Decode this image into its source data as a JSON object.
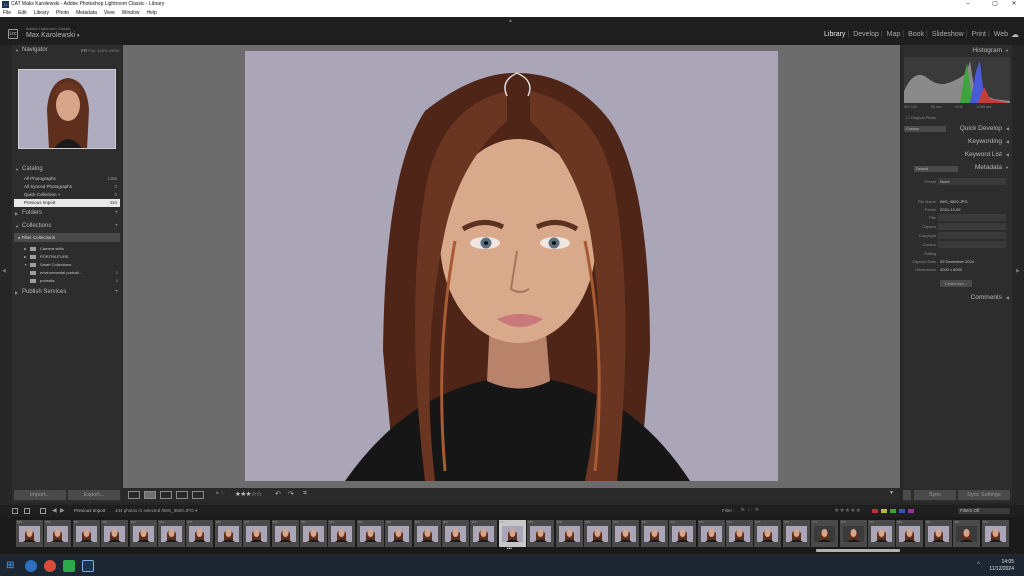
{
  "window": {
    "title": "CAT Maks Karolewski - Adobe Photoshop Lightroom Classic - Library",
    "icon_text": "Lr",
    "controls": [
      "–",
      "▢",
      "✕"
    ]
  },
  "menu": [
    "File",
    "Edit",
    "Library",
    "Photo",
    "Metadata",
    "View",
    "Window",
    "Help"
  ],
  "identity": {
    "small": "Adobe Lightroom Classic",
    "name": "Max Karolewski",
    "logo": "Lrc"
  },
  "modules": [
    "Library",
    "Develop",
    "Map",
    "Book",
    "Slideshow",
    "Print",
    "Web"
  ],
  "active_module": "Library",
  "left": {
    "navigator": {
      "title": "Navigator",
      "zoom": [
        "FIT",
        "FILL",
        "100%",
        "200%"
      ]
    },
    "catalog": {
      "title": "Catalog",
      "items": [
        {
          "label": "All Photographs",
          "count": "1456"
        },
        {
          "label": "All Synced Photographs",
          "count": "0"
        },
        {
          "label": "Quick Collection +",
          "count": "0"
        },
        {
          "label": "Previous Import",
          "count": "434"
        }
      ]
    },
    "folders": {
      "title": "Folders"
    },
    "collections": {
      "title": "Collections",
      "filter": "Filter Collections",
      "items": [
        {
          "label": "Camera skills",
          "count": ""
        },
        {
          "label": "PORTRAITURE",
          "count": ""
        },
        {
          "label": "Smart Collections",
          "count": ""
        },
        {
          "label": "environmental portrait...",
          "count": "1"
        },
        {
          "label": "portraits",
          "count": "0"
        }
      ]
    },
    "publish": {
      "title": "Publish Services"
    },
    "import_label": "Import...",
    "export_label": "Export..."
  },
  "right": {
    "histogram": {
      "title": "Histogram",
      "info": [
        "ISO 100",
        "85 mm",
        "f/2.8",
        "1/160 sec"
      ],
      "original_photo": "Original Photo"
    },
    "quick_develop": {
      "title": "Quick Develop",
      "preset": "Custom"
    },
    "keywording": {
      "title": "Keywording"
    },
    "keyword_list": {
      "title": "Keyword List"
    },
    "metadata": {
      "title": "Metadata",
      "preset_selector": "Default",
      "preset_label": "Preset",
      "preset_value": "None",
      "fields": [
        {
          "key": "File Name",
          "value": "IMG_9820.JPG",
          "box": false
        },
        {
          "key": "Folder",
          "value": "2024-12-09",
          "box": false
        },
        {
          "key": "Title",
          "value": "",
          "box": true
        },
        {
          "key": "Caption",
          "value": "",
          "box": true
        },
        {
          "key": "Copyright",
          "value": "",
          "box": true
        },
        {
          "key": "Creator",
          "value": "",
          "box": true
        },
        {
          "key": "Rating",
          "value": "",
          "box": false
        },
        {
          "key": "Capture Date",
          "value": "09 December 2024",
          "box": false
        },
        {
          "key": "Dimensions",
          "value": "4000 x 6000",
          "box": false
        }
      ],
      "customize": "Customize..."
    },
    "comments": {
      "title": "Comments"
    },
    "sync_label": "Sync",
    "sync_settings_label": "Sync Settings"
  },
  "toolbar": {
    "rating_stars": "★★★☆☆"
  },
  "filmstrip_header": {
    "source": "Previous Import",
    "info": "434 photos /1 selected /IMG_9820.JPG ▾",
    "filter_label": "Filter :",
    "filter_value": "Filters Off",
    "stars": "★★★★★"
  },
  "filmstrip": {
    "numbers": [
      "349",
      "350",
      "351",
      "352",
      "353",
      "354",
      "355",
      "356",
      "357",
      "358",
      "359",
      "360",
      "361",
      "362",
      "363",
      "364",
      "365",
      "366",
      "367",
      "368",
      "369",
      "370",
      "371",
      "372",
      "373",
      "374",
      "375",
      "376",
      "377",
      "378",
      "379",
      "380",
      "381",
      "382",
      "383"
    ],
    "selected_index": 17
  },
  "taskbar": {
    "time": "14:05",
    "date": "11/12/2024"
  },
  "colors": {
    "accent_bg": "#2d2d2d",
    "photo_bg": "#aaa6b8",
    "hair": "#6a3521"
  }
}
